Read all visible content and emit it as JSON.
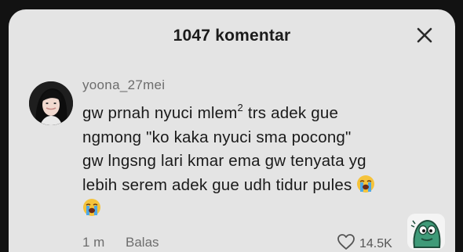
{
  "header": {
    "title": "1047 komentar",
    "close_icon": "close-icon"
  },
  "comment": {
    "username": "yoona_27mei",
    "avatar": "user-avatar",
    "text_line1_a": "gw prnah nyuci mlem",
    "text_line1_sup": "2",
    "text_line1_b": " trs adek gue",
    "text_line2": "ngmong \"ko kaka nyuci sma pocong\"",
    "text_line3": "gw lngsng lari kmar ema gw tenyata yg",
    "text_line4": "lebih serem adek gue udh tidur pules",
    "emoji": "loudly-crying-face-emoji",
    "time": "1 m",
    "reply_label": "Balas",
    "like_count": "14.5K",
    "like_icon": "heart-icon"
  },
  "sticker": {
    "icon": "green-ghost-sticker"
  }
}
